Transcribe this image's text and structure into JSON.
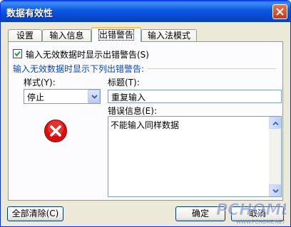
{
  "window": {
    "title": "数据有效性"
  },
  "tabs": [
    {
      "label": "设置"
    },
    {
      "label": "输入信息"
    },
    {
      "label": "出错警告"
    },
    {
      "label": "输入法模式"
    }
  ],
  "error_alert": {
    "show_checkbox_label": "输入无效数据时显示出错警告(S)",
    "show_checkbox_checked": true,
    "group_label": "输入无效数据时显示下列出错警告:",
    "style_label": "样式(Y):",
    "style_value": "停止",
    "title_label": "标题(T):",
    "title_value": "重复输入",
    "message_label": "错误信息(E):",
    "message_value": "不能输入同样数据"
  },
  "buttons": {
    "clear_all": "全部清除(C)",
    "ok": "确定",
    "cancel": "取消"
  },
  "icons": {
    "close": "close-icon",
    "checkmark": "checkmark-icon",
    "dropdown": "chevron-down-icon",
    "error": "error-stop-icon",
    "scroll_up": "scroll-up-arrow-icon",
    "scroll_down": "scroll-down-arrow-icon"
  },
  "watermark": {
    "brand": "PCHOME",
    "site": "WWW.PCHOME.NET"
  },
  "colors": {
    "title_bar": "#0a5be8",
    "group_label": "#0046d5",
    "active_tab_highlight": "#ffc83c",
    "error_icon": "#d90f0f"
  }
}
